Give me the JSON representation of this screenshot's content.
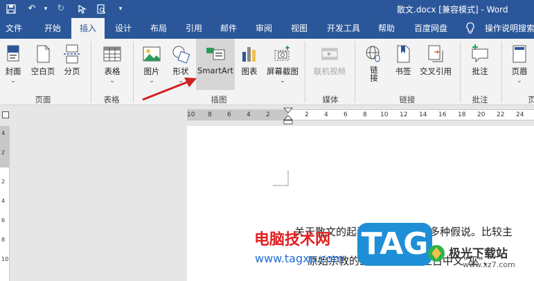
{
  "window": {
    "title": "散文.docx [兼容模式] - Word"
  },
  "tabs": [
    "文件",
    "开始",
    "插入",
    "设计",
    "布局",
    "引用",
    "邮件",
    "审阅",
    "视图",
    "开发工具",
    "帮助",
    "百度网盘",
    "操作说明搜索"
  ],
  "ribbon": {
    "buttons": {
      "cover": "封面",
      "blank": "空白页",
      "pagebreak": "分页",
      "table": "表格",
      "picture": "图片",
      "shapes": "形状",
      "smartart": "SmartArt",
      "chart": "图表",
      "screenshot": "屏幕截图",
      "video": "联机视频",
      "link": "链接",
      "bookmark": "书签",
      "crossref": "交叉引用",
      "comment": "批注",
      "header": "页眉"
    },
    "groups": {
      "pages": "页面",
      "tables": "表格",
      "illustrations": "插图",
      "media": "媒体",
      "links": "链接",
      "comments": "批注",
      "headerfooter": "页"
    }
  },
  "ruler": {
    "ticks": [
      "10",
      "8",
      "6",
      "4",
      "2",
      "2",
      "4",
      "6",
      "8",
      "10",
      "12",
      "14",
      "16",
      "18",
      "20",
      "22",
      "24"
    ]
  },
  "vruler": {
    "ticks": [
      "4",
      "2",
      "2",
      "4",
      "6",
      "8",
      "10"
    ]
  },
  "document": {
    "line1": "关于散文的起源尚不可考，有多种假说。比较主",
    "line2": "原始宗教的巫术仪式，加上古中文\"巫\"、"
  },
  "watermark": {
    "site_name": "电脑技术网",
    "site_url": "www.tagxp.com",
    "tag_text": "TAG",
    "brand_name": "极光下载站",
    "brand_url": "www.xz7.com"
  },
  "colors": {
    "accent": "#2b579a",
    "arrow": "#d02020",
    "watermark_red": "#e02020",
    "tag_blue": "#1e8fd6"
  },
  "icons": [
    "save-icon",
    "undo-icon",
    "redo-icon",
    "touch-mode-icon",
    "print-preview-icon",
    "customize-icon",
    "lightbulb-icon"
  ]
}
